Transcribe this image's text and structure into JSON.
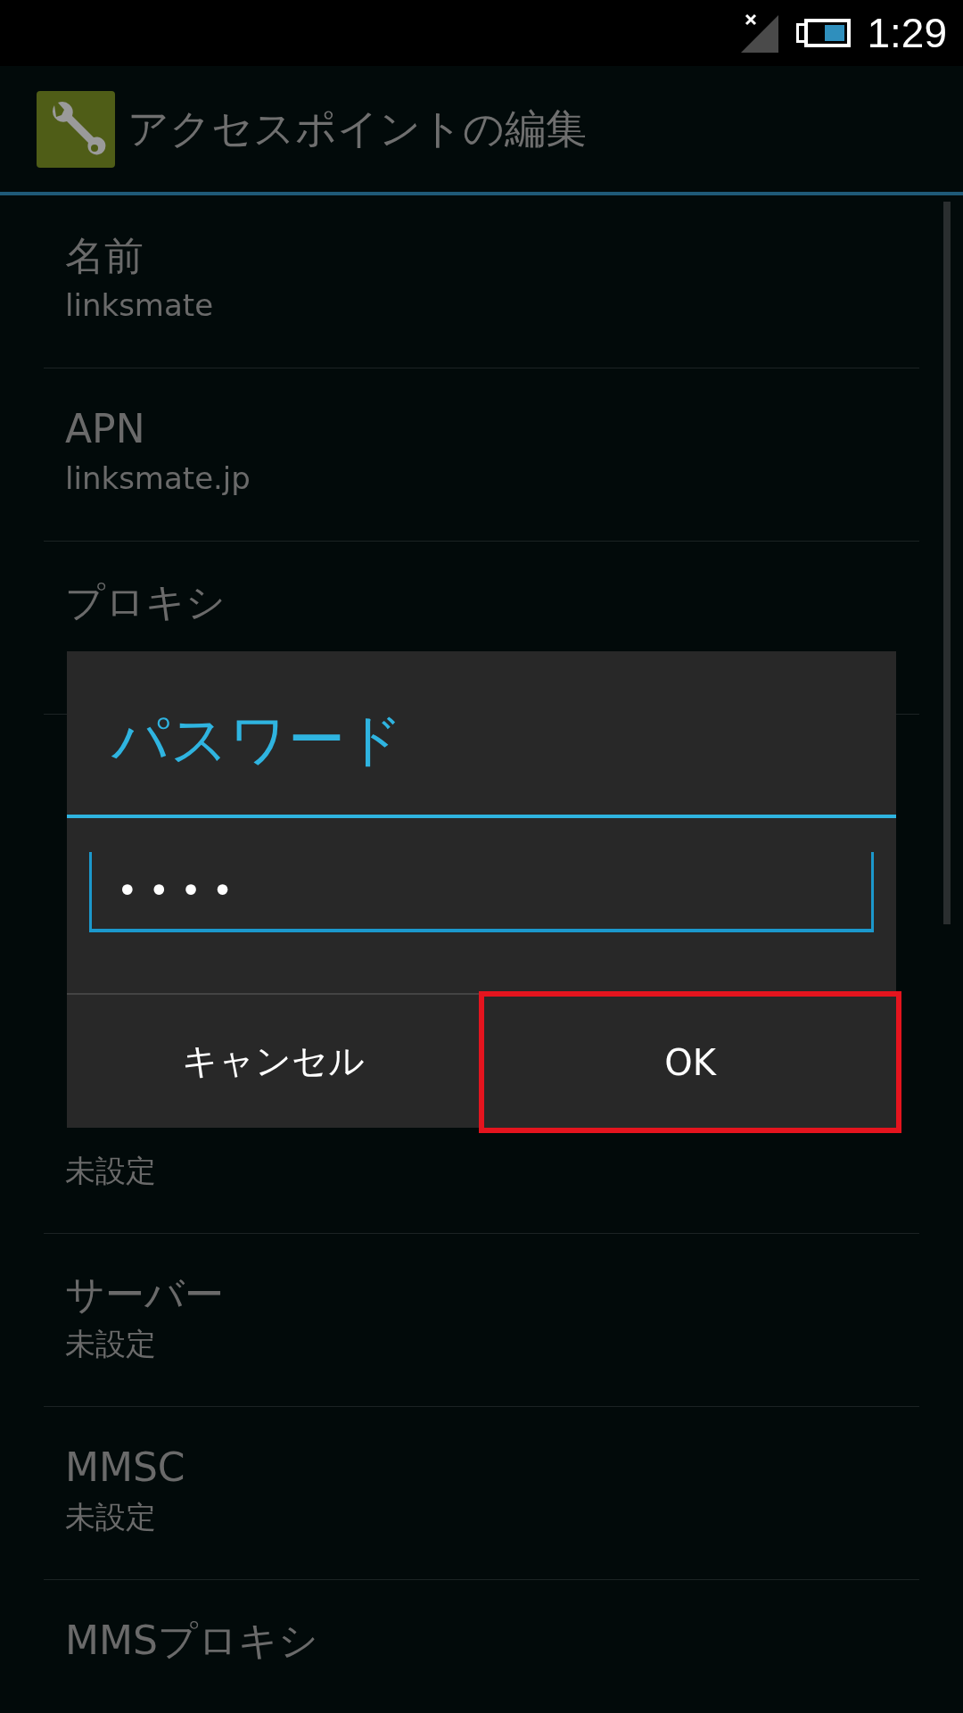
{
  "status_bar": {
    "time": "1:29",
    "signal_disconnected": true,
    "battery": {
      "level": 0.6
    }
  },
  "action_bar": {
    "title": "アクセスポイントの編集"
  },
  "settings": [
    {
      "title": "名前",
      "summary": "linksmate"
    },
    {
      "title": "APN",
      "summary": "linksmate.jp"
    },
    {
      "title": "プロキシ"
    },
    {
      "summary": "未設定"
    },
    {
      "title": "サーバー",
      "summary": "未設定"
    },
    {
      "title": "MMSC",
      "summary": "未設定"
    },
    {
      "title": "MMSプロキシ"
    }
  ],
  "dialog": {
    "title": "パスワード",
    "field": {
      "value": "••••"
    },
    "buttons": [
      {
        "label": "キャンセル",
        "highlighted": false
      },
      {
        "label": "OK",
        "highlighted": true
      }
    ]
  }
}
